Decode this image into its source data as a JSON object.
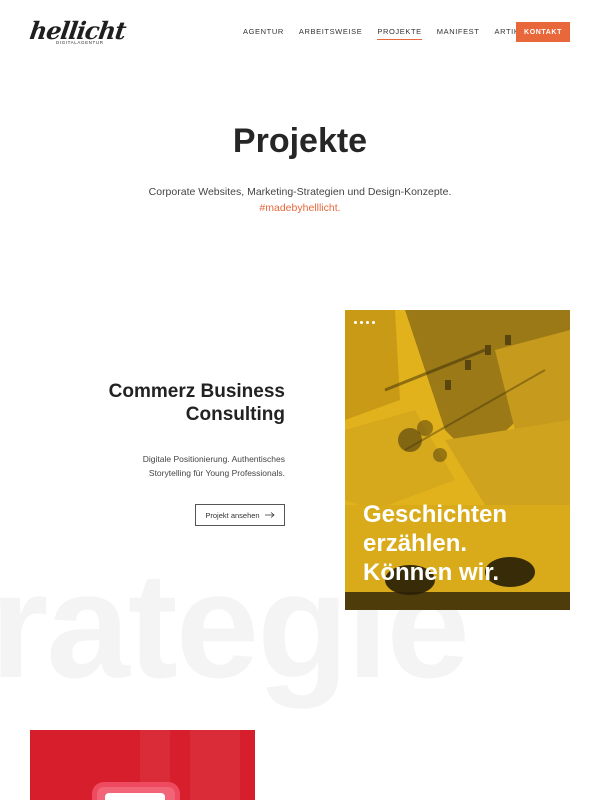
{
  "header": {
    "logo_text": "hellicht",
    "logo_sub": "DIGITALAGENTUR",
    "nav": [
      "AGENTUR",
      "ARBEITSWEISE",
      "PROJEKTE",
      "MANIFEST",
      "ARTIKEL"
    ],
    "active_nav": "PROJEKTE",
    "cta_label": "KONTAKT",
    "accent_color": "#e8683c"
  },
  "hero": {
    "title": "Projekte",
    "subtitle": "Corporate Websites, Marketing-Strategien und Design-Konzepte.",
    "hashtag": "#madebyhelllicht."
  },
  "background_word": "rategie",
  "project": {
    "title_line1": "Commerz Business",
    "title_line2": "Consulting",
    "desc_line1": "Digitale Positionierung. Authentisches",
    "desc_line2": "Storytelling für Young Professionals.",
    "button_label": "Projekt ansehen",
    "button_icon": "arrow-right-icon",
    "quote_line1": "Geschichten",
    "quote_line2": "erzählen.",
    "quote_line3": "Können wir.",
    "image_color": "#e2b21c"
  },
  "next_project": {
    "color": "#d71e2c"
  }
}
